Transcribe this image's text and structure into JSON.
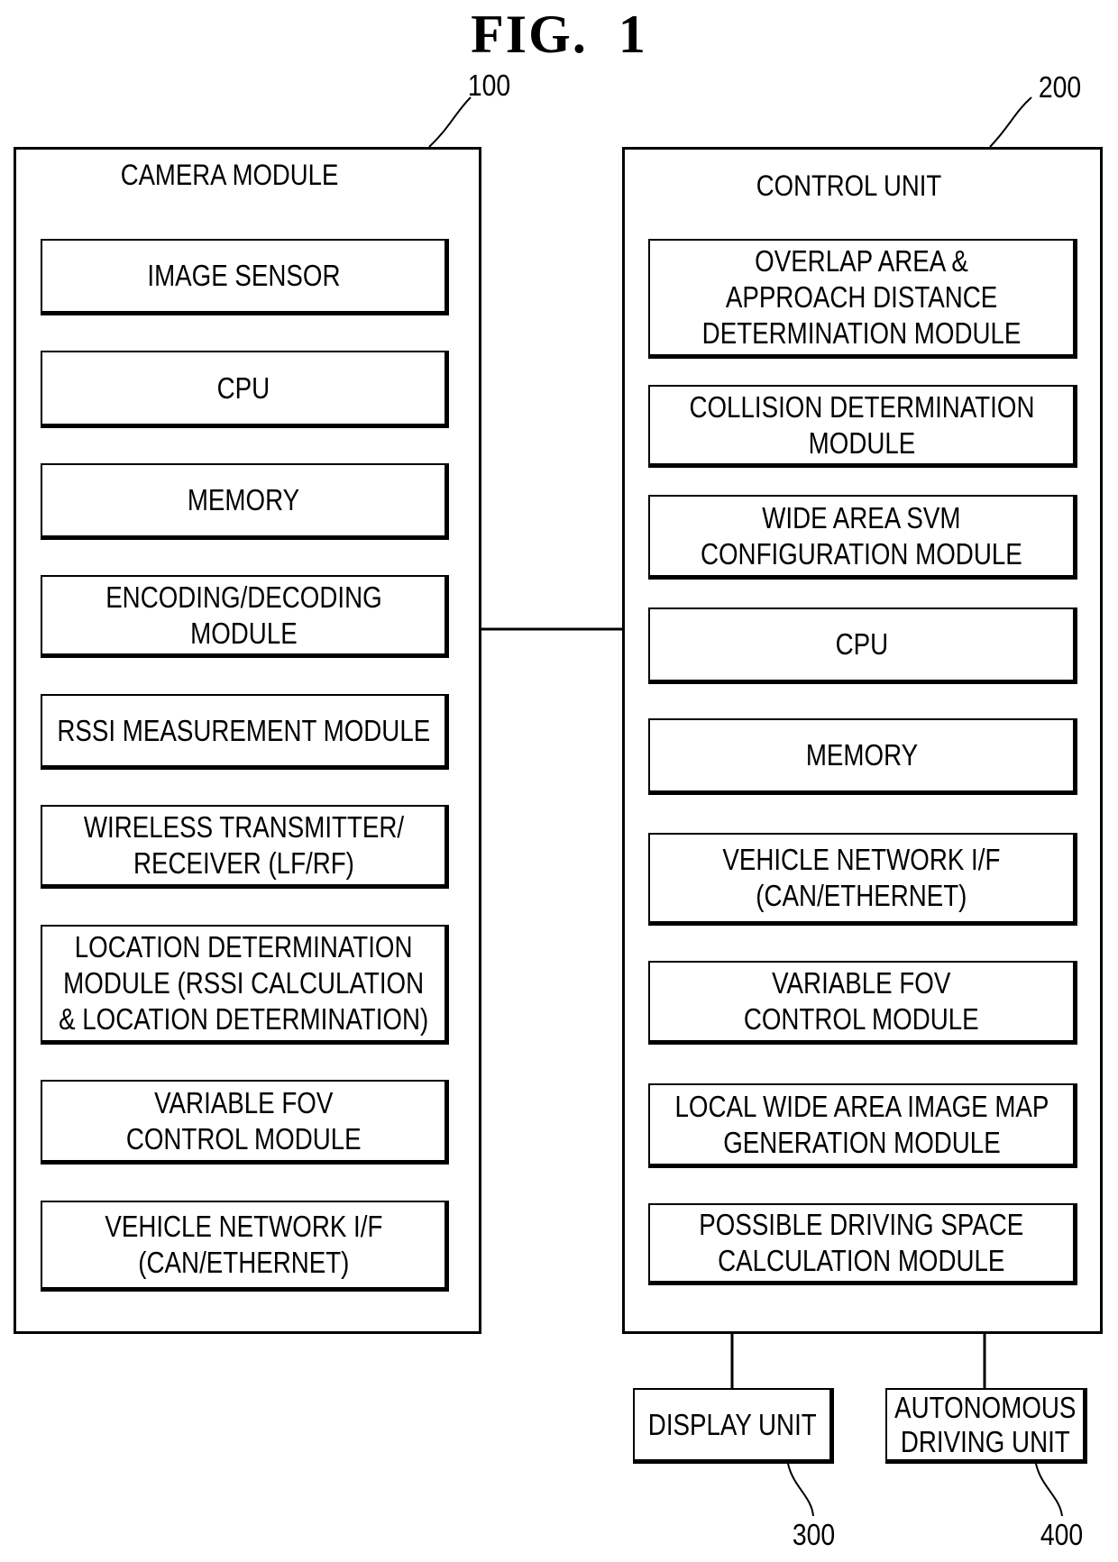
{
  "figure": {
    "title": "FIG.  1"
  },
  "camera_module": {
    "ref": "100",
    "title": "CAMERA MODULE",
    "items": [
      "IMAGE SENSOR",
      "CPU",
      "MEMORY",
      "ENCODING/DECODING\nMODULE",
      "RSSI MEASUREMENT MODULE",
      "WIRELESS TRANSMITTER/\nRECEIVER (LF/RF)",
      "LOCATION DETERMINATION\nMODULE (RSSI CALCULATION\n& LOCATION DETERMINATION)",
      "VARIABLE FOV\nCONTROL MODULE",
      "VEHICLE NETWORK I/F\n(CAN/ETHERNET)"
    ]
  },
  "control_unit": {
    "ref": "200",
    "title": "CONTROL UNIT",
    "items": [
      "OVERLAP AREA &\nAPPROACH DISTANCE\nDETERMINATION MODULE",
      "COLLISION DETERMINATION\nMODULE",
      "WIDE AREA SVM\nCONFIGURATION MODULE",
      "CPU",
      "MEMORY",
      "VEHICLE NETWORK I/F\n(CAN/ETHERNET)",
      "VARIABLE FOV\nCONTROL MODULE",
      "LOCAL WIDE AREA IMAGE MAP\nGENERATION MODULE",
      "POSSIBLE DRIVING SPACE\nCALCULATION MODULE"
    ]
  },
  "display_unit": {
    "ref": "300",
    "label": "DISPLAY UNIT"
  },
  "autonomous_unit": {
    "ref": "400",
    "label": "AUTONOMOUS\nDRIVING UNIT"
  }
}
